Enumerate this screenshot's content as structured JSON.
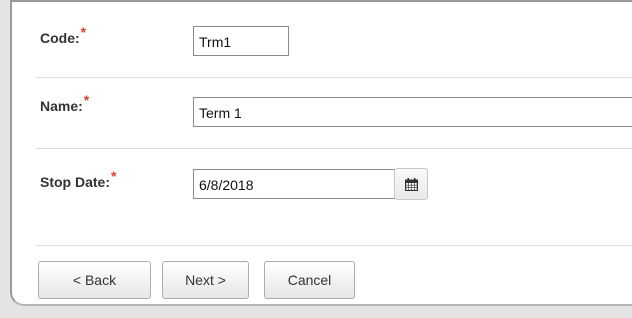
{
  "form": {
    "code": {
      "label": "Code:",
      "required_mark": "*",
      "value": "Trm1"
    },
    "name": {
      "label": "Name:",
      "required_mark": "*",
      "value": "Term 1"
    },
    "stop_date": {
      "label": "Stop Date:",
      "required_mark": "*",
      "value": "6/8/2018",
      "calendar_icon": "calendar-icon"
    }
  },
  "buttons": {
    "back": "< Back",
    "next": "Next >",
    "cancel": "Cancel"
  }
}
